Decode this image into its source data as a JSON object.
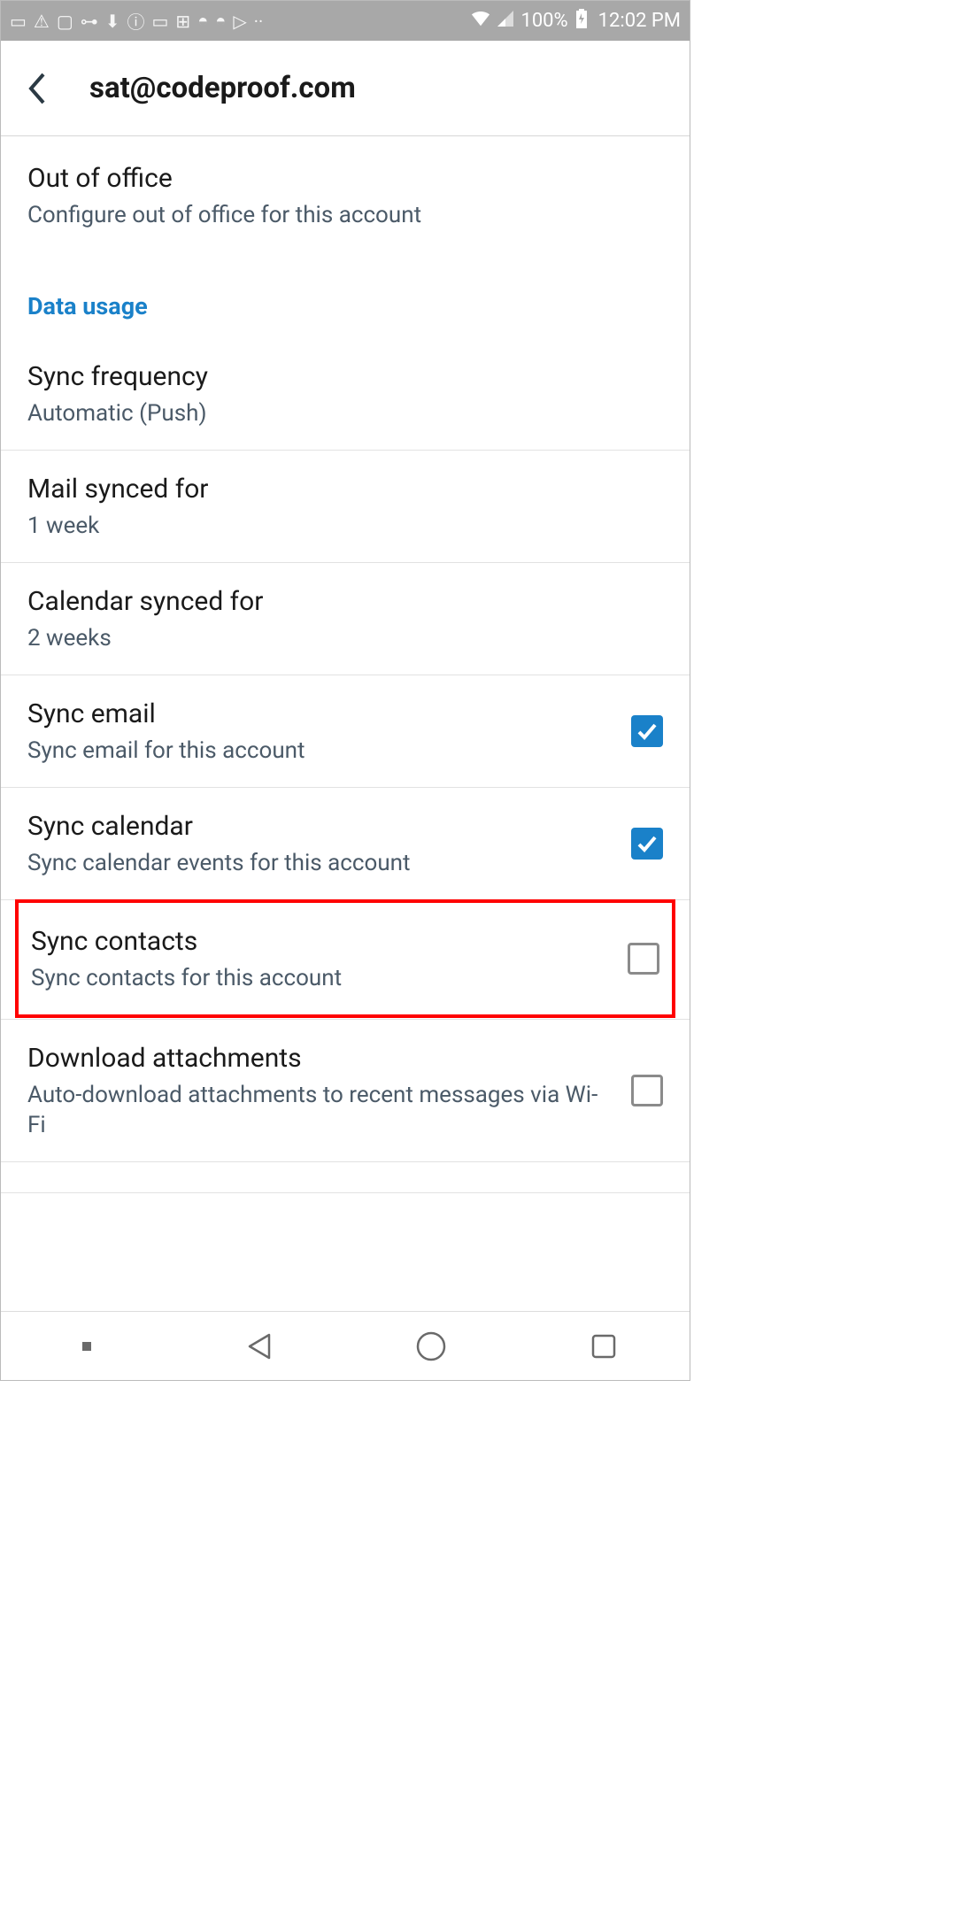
{
  "statusbar": {
    "battery": "100%",
    "time": "12:02 PM"
  },
  "header": {
    "title": "sat@codeproof.com"
  },
  "rows": {
    "out_of_office": {
      "title": "Out of office",
      "subtitle": "Configure out of office for this account"
    },
    "section_data_usage": "Data usage",
    "sync_frequency": {
      "title": "Sync frequency",
      "subtitle": "Automatic (Push)"
    },
    "mail_synced": {
      "title": "Mail synced for",
      "subtitle": "1 week"
    },
    "calendar_synced": {
      "title": "Calendar synced for",
      "subtitle": "2 weeks"
    },
    "sync_email": {
      "title": "Sync email",
      "subtitle": "Sync email for this account",
      "checked": true
    },
    "sync_calendar": {
      "title": "Sync calendar",
      "subtitle": "Sync calendar events for this account",
      "checked": true
    },
    "sync_contacts": {
      "title": "Sync contacts",
      "subtitle": "Sync contacts for this account",
      "checked": false
    },
    "download_attachments": {
      "title": "Download attachments",
      "subtitle": "Auto-download attachments to recent messages via Wi-Fi",
      "checked": false
    }
  }
}
